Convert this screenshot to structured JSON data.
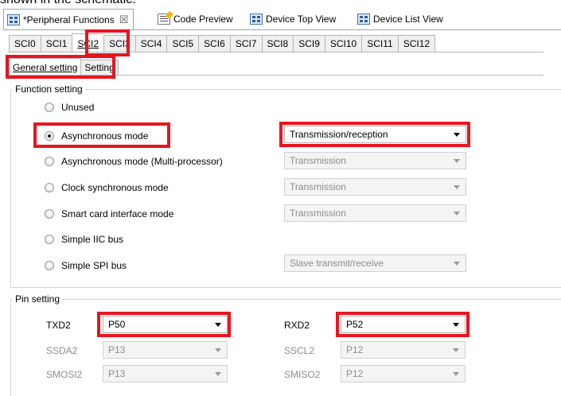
{
  "top_fragment": "shown in the schematic.",
  "editor_tabs": [
    {
      "label": "*Peripheral Functions",
      "icon": "peripheral-functions-icon"
    },
    {
      "label": "Code Preview",
      "icon": "code-preview-icon"
    },
    {
      "label": "Device Top View",
      "icon": "device-top-view-icon"
    },
    {
      "label": "Device List View",
      "icon": "device-list-view-icon"
    }
  ],
  "close_glyph": "☒",
  "sci_tabs": [
    "SCI0",
    "SCI1",
    "SCI2",
    "SCI3",
    "SCI4",
    "SCI5",
    "SCI6",
    "SCI7",
    "SCI8",
    "SCI9",
    "SCI10",
    "SCI11",
    "SCI12"
  ],
  "selected_sci_tab": "SCI2",
  "sub_tabs": [
    "General setting",
    "Setting"
  ],
  "function_setting": {
    "legend": "Function setting",
    "options": [
      {
        "label": "Unused",
        "selected": false
      },
      {
        "label": "Asynchronous mode",
        "selected": true,
        "combo": "Transmission/reception",
        "combo_enabled": true
      },
      {
        "label": "Asynchronous mode (Multi-processor)",
        "selected": false,
        "combo": "Transmission",
        "combo_enabled": false
      },
      {
        "label": "Clock synchronous mode",
        "selected": false,
        "combo": "Transmission",
        "combo_enabled": false
      },
      {
        "label": "Smart card interface mode",
        "selected": false,
        "combo": "Transmission",
        "combo_enabled": false
      },
      {
        "label": "Simple IIC bus",
        "selected": false
      },
      {
        "label": "Simple SPI bus",
        "selected": false,
        "combo": "Slave transmit/receive",
        "combo_enabled": false
      }
    ]
  },
  "pin_setting": {
    "legend": "Pin setting",
    "rows": [
      {
        "left_label": "TXD2",
        "left_value": "P50",
        "left_enabled": true,
        "right_label": "RXD2",
        "right_value": "P52",
        "right_enabled": true
      },
      {
        "left_label": "SSDA2",
        "left_value": "P13",
        "left_enabled": false,
        "right_label": "SSCL2",
        "right_value": "P12",
        "right_enabled": false
      },
      {
        "left_label": "SMOSI2",
        "left_value": "P13",
        "left_enabled": false,
        "right_label": "SMISO2",
        "right_value": "P12",
        "right_enabled": false
      }
    ]
  },
  "highlight_color": "#e8151f"
}
